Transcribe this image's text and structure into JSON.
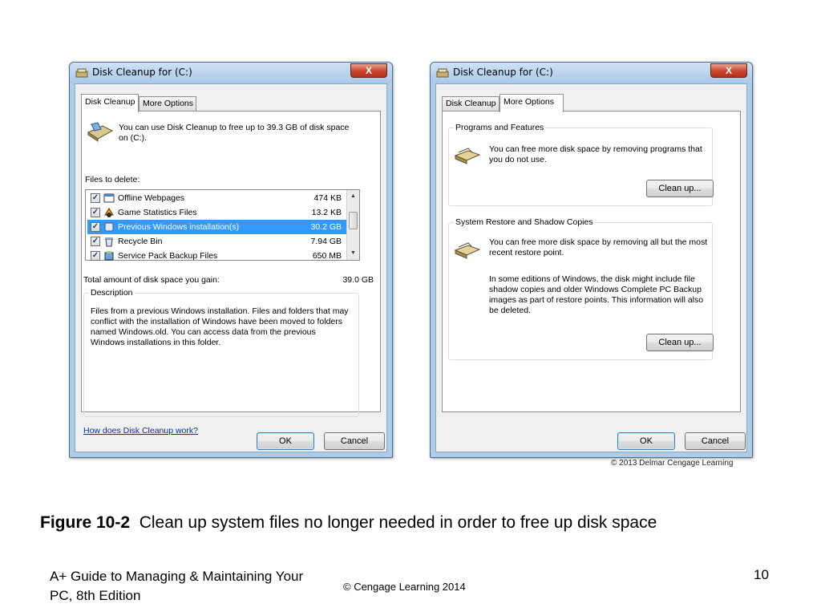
{
  "left_window": {
    "title": "Disk Cleanup for  (C:)",
    "close": "X",
    "tabs": [
      {
        "label": "Disk Cleanup"
      },
      {
        "label": "More Options"
      }
    ],
    "intro": "You can use Disk Cleanup to free up to 39.3 GB of disk space on  (C:).",
    "files_label": "Files to delete:",
    "files": [
      {
        "name": "Offline Webpages",
        "size": "474 KB",
        "checked": true,
        "icon": "webpage-icon"
      },
      {
        "name": "Game Statistics Files",
        "size": "13.2 KB",
        "checked": true,
        "icon": "game-icon"
      },
      {
        "name": "Previous Windows installation(s)",
        "size": "30.2 GB",
        "checked": true,
        "selected": true,
        "icon": "windows-icon"
      },
      {
        "name": "Recycle Bin",
        "size": "7.94 GB",
        "checked": true,
        "icon": "recycle-bin-icon"
      },
      {
        "name": "Service Pack Backup Files",
        "size": "650 MB",
        "checked": true,
        "icon": "service-pack-icon"
      }
    ],
    "total_label": "Total amount of disk space you gain:",
    "total_value": "39.0 GB",
    "description_label": "Description",
    "description": "Files from a previous Windows installation.  Files and folders that may conflict with the installation of Windows have been moved to folders named Windows.old.  You can access data from the previous Windows installations in this folder.",
    "help_link": "How does Disk Cleanup work?",
    "ok": "OK",
    "cancel": "Cancel"
  },
  "right_window": {
    "title": "Disk Cleanup for  (C:)",
    "close": "X",
    "tabs": [
      {
        "label": "Disk Cleanup"
      },
      {
        "label": "More Options"
      }
    ],
    "programs_group": "Programs and Features",
    "programs_text": "You can free more disk space by removing programs that you do not use.",
    "programs_button": "Clean up...",
    "restore_group": "System Restore and Shadow Copies",
    "restore_text": "You can free more disk space by removing all but the most recent restore point.",
    "restore_note": "In some editions of Windows, the disk might include file shadow copies and older Windows Complete PC Backup images as part of restore points. This information will also be deleted.",
    "restore_button": "Clean up...",
    "ok": "OK",
    "cancel": "Cancel"
  },
  "credit": "© 2013 Delmar Cengage Learning",
  "caption": {
    "label": "Figure 10-2",
    "text": "Clean up system files no longer needed in order to free up disk space"
  },
  "footer": {
    "book": "A+ Guide to Managing & Maintaining Your PC, 8th Edition",
    "copyright": "© Cengage Learning  2014",
    "page": "10"
  },
  "colors": {
    "selection": "#3399ff",
    "window_frame": "#aecbe8",
    "link": "#0033aa",
    "close_button": "#c7462c"
  }
}
